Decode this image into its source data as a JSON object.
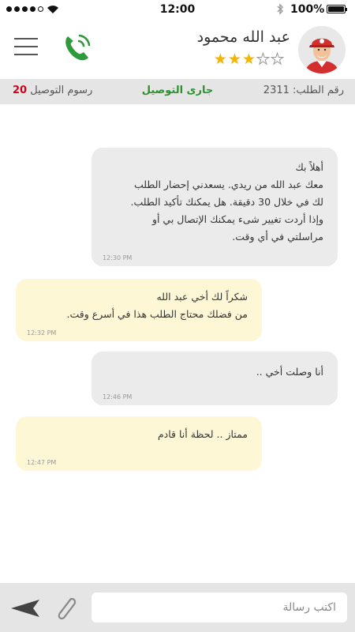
{
  "status_bar": {
    "time": "12:00",
    "battery_percent_text": "100%",
    "battery_level": 1.0,
    "signal_bars_filled": 4,
    "signal_bars_total": 5
  },
  "header": {
    "driver_name": "عبد الله محمود",
    "rating": 3,
    "rating_max": 5,
    "star_color": "#f5b400",
    "call_color": "#2e9b3a"
  },
  "order_bar": {
    "order_label": "رقم الطلب:",
    "order_number": "2311",
    "status": "جارى التوصيل",
    "status_color": "#2f8f2f",
    "fee_label": "رسوم التوصيل",
    "fee_value": "20",
    "fee_color": "#d0021b"
  },
  "messages": [
    {
      "side": "in",
      "lines": [
        "أهلاً بك",
        "معك عبد الله من ريدي. يسعدني إحضار الطلب",
        "لك في خلال 30 دقيقة. هل يمكنك تأكيد الطلب.",
        "وإذا أردت تغيير شىء يمكنك الإتصال بي أو",
        "مراسلتي في أي وقت."
      ],
      "time": "12:30 PM"
    },
    {
      "side": "out",
      "lines": [
        "شكراً لك أخي عبد الله",
        "من فضلك محتاج الطلب هذا في أسرع وقت."
      ],
      "time": "12:32 PM"
    },
    {
      "side": "in",
      "lines": [
        "أنا وصلت أخي .."
      ],
      "time": "12:46 PM"
    },
    {
      "side": "out",
      "lines": [
        "ممتاز .. لحظة أنا قادم"
      ],
      "time": "12:47 PM"
    }
  ],
  "composer": {
    "placeholder": "اكتب رسالة",
    "value": ""
  },
  "colors": {
    "incoming_bubble": "#ebebeb",
    "outgoing_bubble": "#fdf7d6",
    "bar_background": "#e5e5e5"
  },
  "icons": {
    "menu": "hamburger-menu-icon",
    "call": "phone-icon",
    "send": "send-icon",
    "attach": "paperclip-icon",
    "star": "star-icon",
    "wifi": "wifi-icon",
    "bluetooth": "bluetooth-icon",
    "battery": "battery-icon"
  }
}
